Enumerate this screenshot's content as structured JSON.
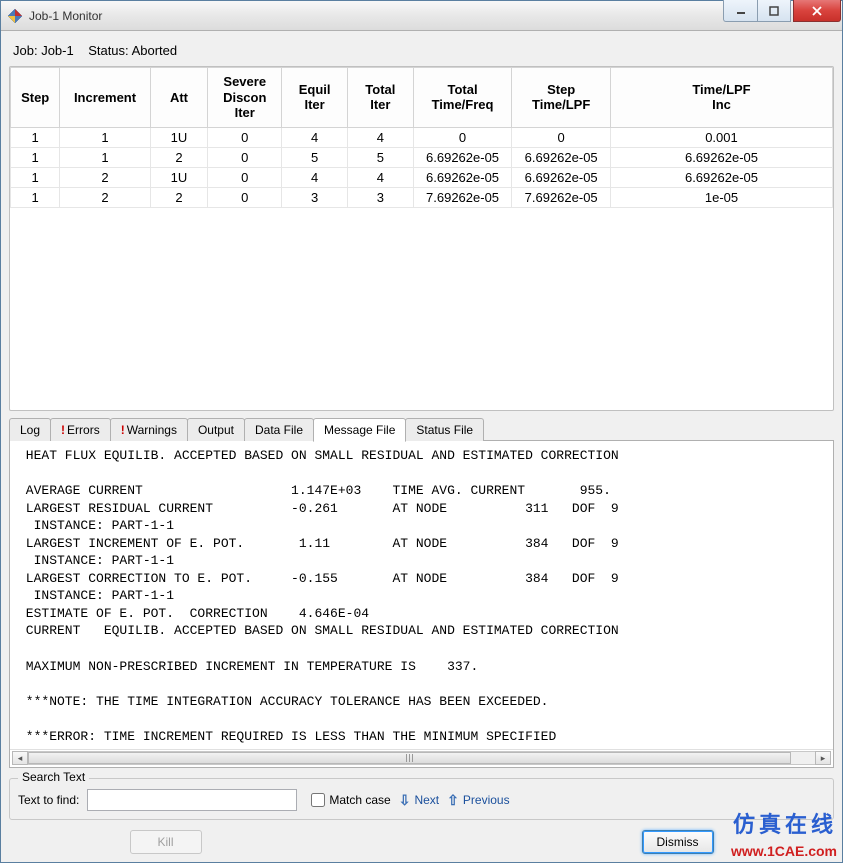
{
  "window": {
    "title": "Job-1 Monitor"
  },
  "job_info": {
    "job_label": "Job:",
    "job_name": "Job-1",
    "status_label": "Status:",
    "status_value": "Aborted"
  },
  "table": {
    "headers": [
      "Step",
      "Increment",
      "Att",
      "Severe\nDiscon\nIter",
      "Equil\nIter",
      "Total\nIter",
      "Total\nTime/Freq",
      "Step\nTime/LPF",
      "Time/LPF\nInc"
    ],
    "rows": [
      [
        "1",
        "1",
        "1U",
        "0",
        "4",
        "4",
        "0",
        "0",
        "0.001"
      ],
      [
        "1",
        "1",
        "2",
        "0",
        "5",
        "5",
        "6.69262e-05",
        "6.69262e-05",
        "6.69262e-05"
      ],
      [
        "1",
        "2",
        "1U",
        "0",
        "4",
        "4",
        "6.69262e-05",
        "6.69262e-05",
        "6.69262e-05"
      ],
      [
        "1",
        "2",
        "2",
        "0",
        "3",
        "3",
        "7.69262e-05",
        "7.69262e-05",
        "1e-05"
      ]
    ]
  },
  "tabs": {
    "items": [
      {
        "label": "Log",
        "warn": false
      },
      {
        "label": "Errors",
        "warn": true
      },
      {
        "label": "Warnings",
        "warn": true
      },
      {
        "label": "Output",
        "warn": false
      },
      {
        "label": "Data File",
        "warn": false
      },
      {
        "label": "Message File",
        "warn": false
      },
      {
        "label": "Status File",
        "warn": false
      }
    ],
    "active_index": 5
  },
  "message_text": " HEAT FLUX EQUILIB. ACCEPTED BASED ON SMALL RESIDUAL AND ESTIMATED CORRECTION\n\n AVERAGE CURRENT                   1.147E+03    TIME AVG. CURRENT       955.\n LARGEST RESIDUAL CURRENT          -0.261       AT NODE          311   DOF  9\n  INSTANCE: PART-1-1\n LARGEST INCREMENT OF E. POT.       1.11        AT NODE          384   DOF  9\n  INSTANCE: PART-1-1\n LARGEST CORRECTION TO E. POT.     -0.155       AT NODE          384   DOF  9\n  INSTANCE: PART-1-1\n ESTIMATE OF E. POT.  CORRECTION    4.646E-04\n CURRENT   EQUILIB. ACCEPTED BASED ON SMALL RESIDUAL AND ESTIMATED CORRECTION\n\n MAXIMUM NON-PRESCRIBED INCREMENT IN TEMPERATURE IS    337.\n\n ***NOTE: THE TIME INTEGRATION ACCURACY TOLERANCE HAS BEEN EXCEEDED.\n\n ***ERROR: TIME INCREMENT REQUIRED IS LESS THAN THE MINIMUM SPECIFIED\n",
  "search": {
    "group_label": "Search Text",
    "find_label": "Text to find:",
    "find_value": "",
    "match_case": "Match case",
    "next": "Next",
    "previous": "Previous"
  },
  "buttons": {
    "kill": "Kill",
    "dismiss": "Dismiss"
  },
  "watermark": {
    "cn": "仿真在线",
    "url": "www.1CAE.com"
  }
}
